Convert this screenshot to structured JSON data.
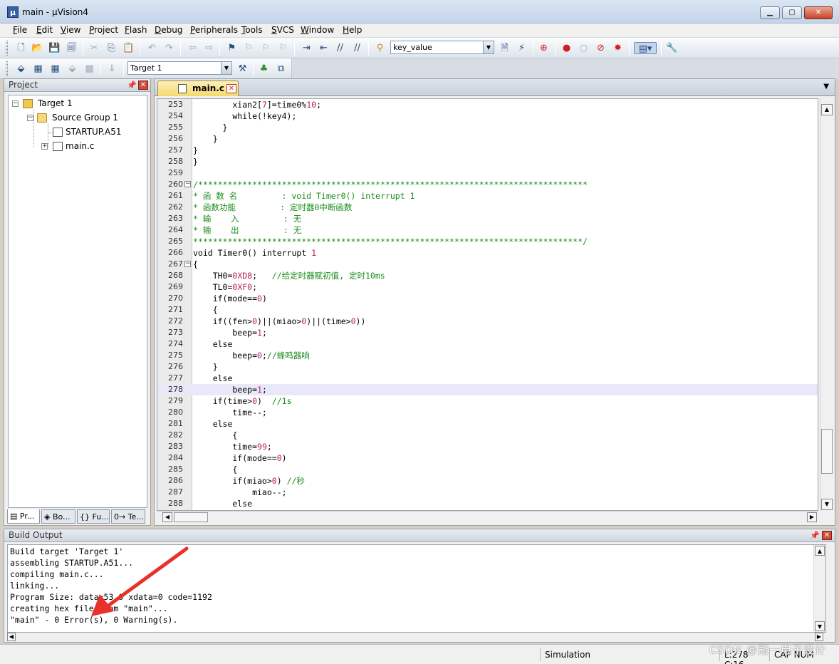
{
  "window": {
    "title": "main  - µVision4",
    "minimize": "▁",
    "maximize": "▢",
    "close": "✕"
  },
  "menu": [
    "File",
    "Edit",
    "View",
    "Project",
    "Flash",
    "Debug",
    "Peripherals",
    "Tools",
    "SVCS",
    "Window",
    "Help"
  ],
  "toolbar": {
    "find_combo_value": "key_value",
    "target_combo_value": "Target 1"
  },
  "project_panel": {
    "title": "Project",
    "tree": {
      "target": "Target 1",
      "group": "Source Group 1",
      "files": [
        "STARTUP.A51",
        "main.c"
      ]
    },
    "tabs": [
      "Pr...",
      "Bo...",
      "{} Fu...",
      "0→ Te..."
    ]
  },
  "editor": {
    "active_tab": "main.c",
    "highlight_line": 278,
    "lines": [
      {
        "n": 253,
        "code": "        xian2[7]=time0%10;"
      },
      {
        "n": 254,
        "code": "        while(!key4);"
      },
      {
        "n": 255,
        "code": "      }"
      },
      {
        "n": 256,
        "code": "    }"
      },
      {
        "n": 257,
        "code": "}"
      },
      {
        "n": 258,
        "code": "}"
      },
      {
        "n": 259,
        "code": ""
      },
      {
        "n": 260,
        "code": "/*******************************************************************************",
        "fold": "-",
        "comment": true
      },
      {
        "n": 261,
        "code": "* 函 数 名         : void Timer0() interrupt 1",
        "comment": true
      },
      {
        "n": 262,
        "code": "* 函数功能         : 定时器0中断函数",
        "comment": true
      },
      {
        "n": 263,
        "code": "* 输    入         : 无",
        "comment": true
      },
      {
        "n": 264,
        "code": "* 输    出         : 无",
        "comment": true
      },
      {
        "n": 265,
        "code": "*******************************************************************************/",
        "comment": true
      },
      {
        "n": 266,
        "code": "void Timer0() interrupt 1"
      },
      {
        "n": 267,
        "code": "{",
        "fold": "-"
      },
      {
        "n": 268,
        "code": "    TH0=0XD8;   //给定时器赋初值, 定时10ms"
      },
      {
        "n": 269,
        "code": "    TL0=0XF0;"
      },
      {
        "n": 270,
        "code": "    if(mode==0)"
      },
      {
        "n": 271,
        "code": "    {"
      },
      {
        "n": 272,
        "code": "    if((fen>0)||(miao>0)||(time>0))"
      },
      {
        "n": 273,
        "code": "        beep=1;"
      },
      {
        "n": 274,
        "code": "    else"
      },
      {
        "n": 275,
        "code": "        beep=0;//蜂鸣器响"
      },
      {
        "n": 276,
        "code": "    }"
      },
      {
        "n": 277,
        "code": "    else"
      },
      {
        "n": 278,
        "code": "        beep=1;"
      },
      {
        "n": 279,
        "code": "    if(time>0)  //1s"
      },
      {
        "n": 280,
        "code": "        time--;"
      },
      {
        "n": 281,
        "code": "    else"
      },
      {
        "n": 282,
        "code": "        {"
      },
      {
        "n": 283,
        "code": "        time=99;"
      },
      {
        "n": 284,
        "code": "        if(mode==0)"
      },
      {
        "n": 285,
        "code": "        {"
      },
      {
        "n": 286,
        "code": "        if(miao>0) //秒"
      },
      {
        "n": 287,
        "code": "            miao--;"
      },
      {
        "n": 288,
        "code": "        else"
      }
    ]
  },
  "build_output": {
    "title": "Build Output",
    "lines": [
      "Build target 'Target 1'",
      "assembling STARTUP.A51...",
      "compiling main.c...",
      "linking...",
      "Program Size: data=53.0 xdata=0 code=1192",
      "creating hex file from \"main\"...",
      "\"main\" - 0 Error(s), 0 Warning(s)."
    ]
  },
  "status": {
    "mode": "Simulation",
    "position": "L:278 C:16",
    "flags": "CAP  NUM"
  },
  "watermark": "CSDN @冠一电子设计",
  "colors": {
    "comment": "#1a8c1a",
    "number": "#b8205a",
    "highlight": "#e8e8f8",
    "arrow": "#e8312a"
  }
}
